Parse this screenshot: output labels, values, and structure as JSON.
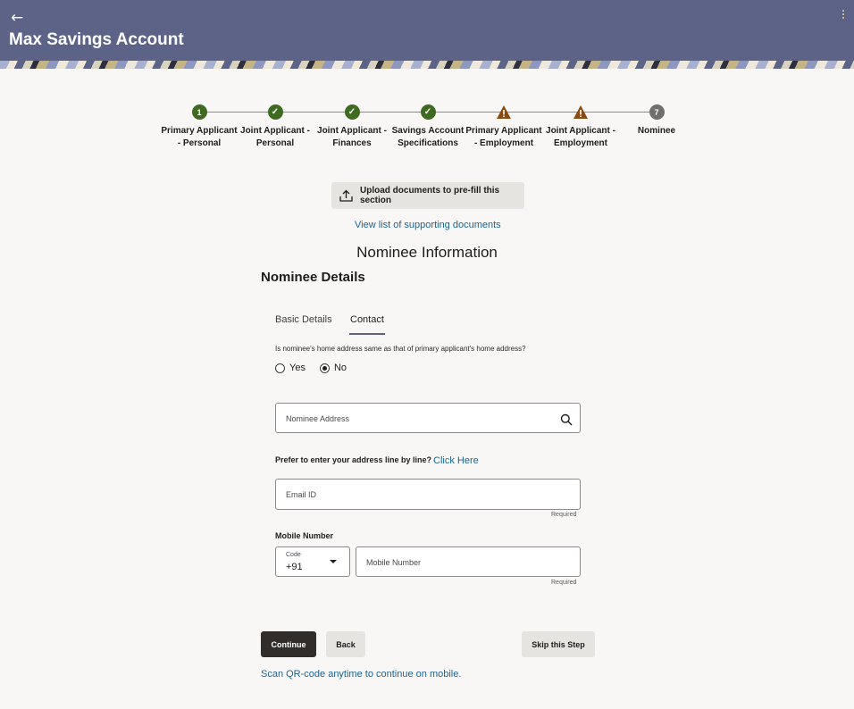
{
  "header": {
    "title": "Max Savings Account"
  },
  "stepper": {
    "steps": [
      {
        "marker": "1",
        "status": "current",
        "label": "Primary Applicant - Personal"
      },
      {
        "marker": "✓",
        "status": "done",
        "label": "Joint Applicant - Personal"
      },
      {
        "marker": "✓",
        "status": "done",
        "label": "Joint Applicant - Finances"
      },
      {
        "marker": "✓",
        "status": "done",
        "label": "Savings Account Specifications"
      },
      {
        "marker": "!",
        "status": "warning",
        "label": "Primary Applicant - Employment"
      },
      {
        "marker": "!",
        "status": "warning",
        "label": "Joint Applicant - Employment"
      },
      {
        "marker": "7",
        "status": "pending",
        "label": "Nominee"
      }
    ]
  },
  "upload": {
    "label": "Upload documents to pre-fill this section"
  },
  "links": {
    "supporting_documents": "View list of supporting documents",
    "click_here": "Click Here",
    "qr_code": "Scan QR-code anytime to continue on mobile."
  },
  "section": {
    "title": "Nominee Information",
    "subtitle": "Nominee Details"
  },
  "tabs": {
    "basic": "Basic Details",
    "contact": "Contact"
  },
  "form": {
    "question": "Is nominee's home address same as that of primary applicant's home address?",
    "radio_yes": "Yes",
    "radio_no": "No",
    "selected": "No",
    "address_placeholder": "Nominee Address",
    "prefer_text": "Prefer to enter your address line by line?",
    "email_placeholder": "Email ID",
    "required": "Required",
    "mobile_label": "Mobile Number",
    "code_label": "Code",
    "code_value": "+91",
    "mobile_placeholder": "Mobile Number"
  },
  "buttons": {
    "continue": "Continue",
    "back": "Back",
    "skip": "Skip this Step"
  },
  "colors": {
    "header_bg": "#5d6386",
    "step_done": "#3f6b21",
    "step_warning": "#8a4a10",
    "link": "#1c6494",
    "primary_button": "#312d2a"
  }
}
